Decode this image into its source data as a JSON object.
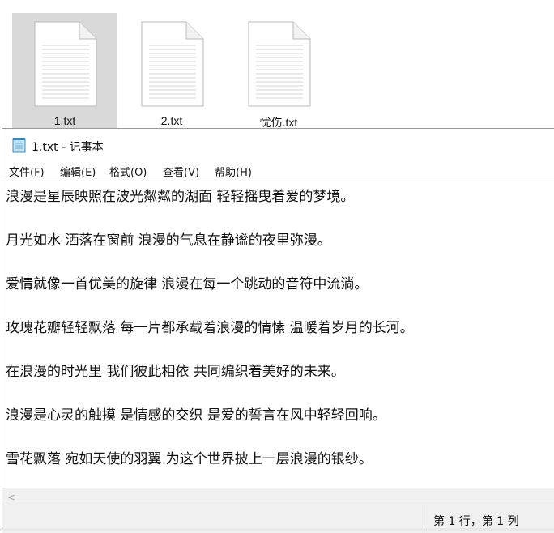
{
  "desktop": {
    "files": [
      {
        "name": "1.txt",
        "selected": true
      },
      {
        "name": "2.txt",
        "selected": false
      },
      {
        "name": "忧伤.txt",
        "selected": false
      }
    ]
  },
  "window": {
    "title": "1.txt - 记事本",
    "app_icon": "notepad-icon"
  },
  "menu": {
    "file": "文件(F)",
    "edit": "编辑(E)",
    "format": "格式(O)",
    "view": "查看(V)",
    "help": "帮助(H)"
  },
  "editor": {
    "lines": [
      "浪漫是星辰映照在波光粼粼的湖面 轻轻摇曳着爱的梦境。",
      "月光如水 洒落在窗前 浪漫的气息在静谧的夜里弥漫。",
      "爱情就像一首优美的旋律 浪漫在每一个跳动的音符中流淌。",
      "玫瑰花瓣轻轻飘落 每一片都承载着浪漫的情愫 温暖着岁月的长河。",
      "在浪漫的时光里 我们彼此相依 共同编织着美好的未来。",
      "浪漫是心灵的触摸 是情感的交织 是爱的誓言在风中轻轻回响。",
      "雪花飘落 宛如天使的羽翼 为这个世界披上一层浪漫的银纱。"
    ]
  },
  "scrollbar": {
    "left_arrow": "<"
  },
  "status": {
    "position": "第 1 行，第 1 列"
  }
}
